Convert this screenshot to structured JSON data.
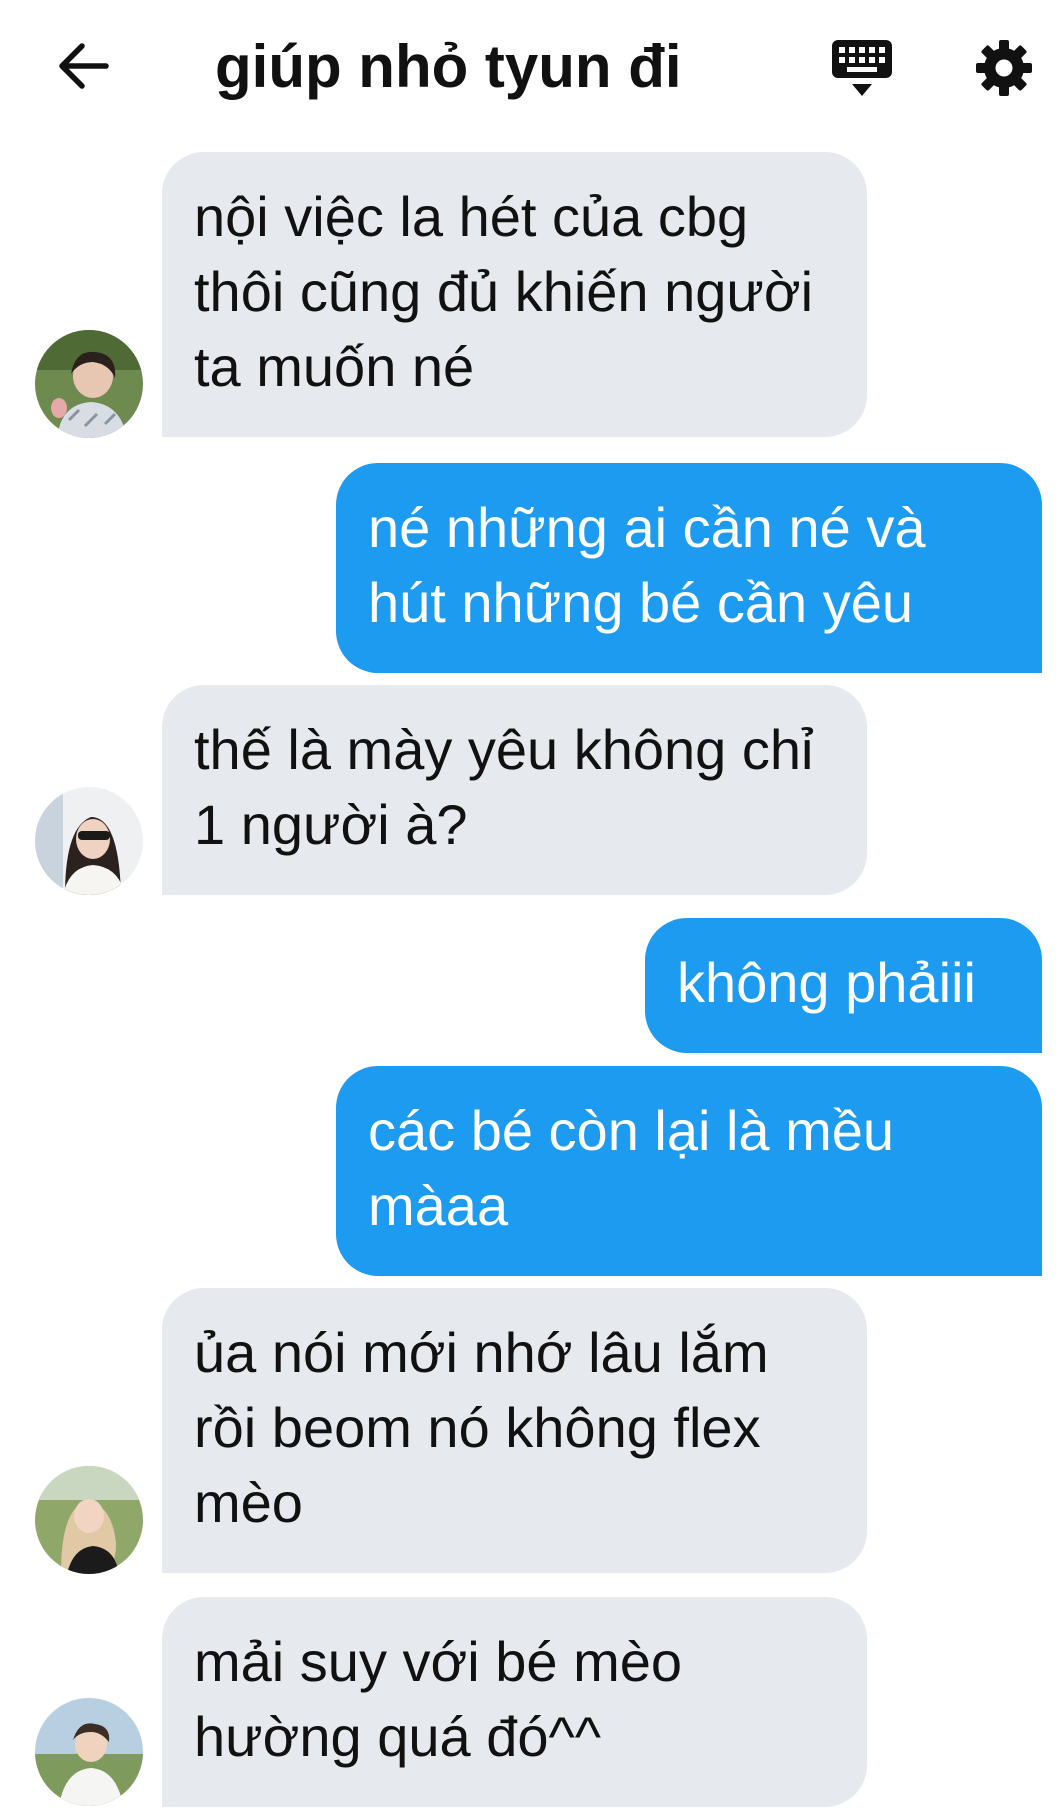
{
  "header": {
    "title": "giúp nhỏ tyun đi",
    "back_icon": "arrow-left-icon",
    "keyboard_icon": "keyboard-icon",
    "settings_icon": "gear-icon"
  },
  "colors": {
    "incoming_bubble": "#e6e9ed",
    "outgoing_bubble": "#1d9bf0",
    "outgoing_text": "#ffffff",
    "text": "#111111"
  },
  "messages": [
    {
      "direction": "incoming",
      "text": "nội việc la hét của cbg thôi cũng đủ khiến người ta muốn né"
    },
    {
      "direction": "outgoing",
      "text": "né những ai cần né và hút những bé cần yêu"
    },
    {
      "direction": "incoming",
      "text": "thế là mày yêu không chỉ 1 người à?"
    },
    {
      "direction": "outgoing",
      "text": "không phảiii"
    },
    {
      "direction": "outgoing",
      "text": "các bé còn lại là mều màaa"
    },
    {
      "direction": "incoming",
      "text": "ủa nói mới nhớ lâu lắm rồi beom nó không flex mèo"
    },
    {
      "direction": "incoming",
      "text": "mải suy với bé mèo hường quá đó^^"
    }
  ]
}
